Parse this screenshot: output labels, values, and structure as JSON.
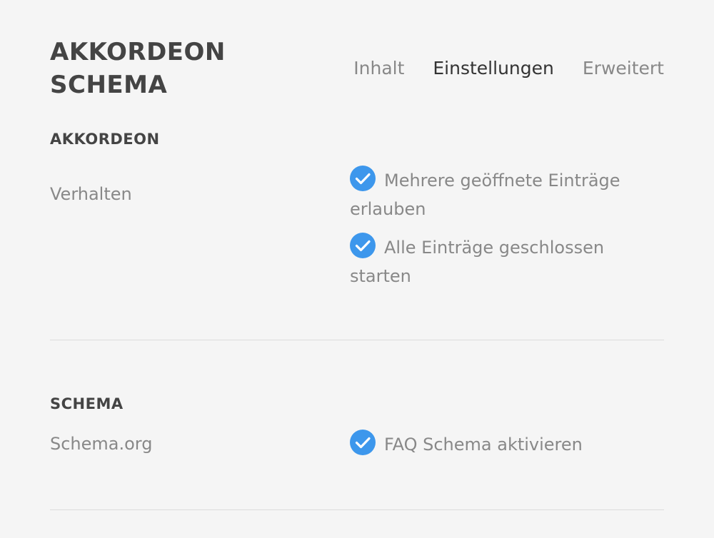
{
  "panel": {
    "title": "AKKORDEON SCHEMA"
  },
  "tabs": [
    {
      "label": "Inhalt",
      "active": false
    },
    {
      "label": "Einstellungen",
      "active": true
    },
    {
      "label": "Erweitert",
      "active": false
    }
  ],
  "sections": [
    {
      "heading": "AKKORDEON",
      "field_label": "Verhalten",
      "options": [
        {
          "label": "Mehrere geöffnete Einträge erlauben",
          "checked": true
        },
        {
          "label": "Alle Einträge geschlossen starten",
          "checked": true
        }
      ]
    },
    {
      "heading": "SCHEMA",
      "field_label": "Schema.org",
      "options": [
        {
          "label": "FAQ Schema aktivieren",
          "checked": true
        }
      ]
    }
  ],
  "colors": {
    "accent": "#3d97ec",
    "background": "#f5f5f5",
    "divider": "#dcdcdc"
  },
  "icons": {
    "checkbox": "checkmark-circle-icon"
  }
}
